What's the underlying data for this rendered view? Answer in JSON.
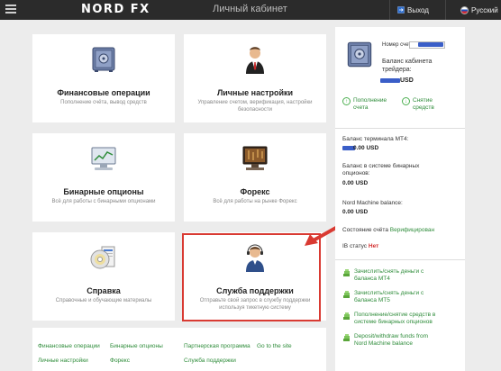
{
  "header": {
    "logo_left": "NORD",
    "logo_right": "FX",
    "title": "Личный кабинет",
    "logout_label": "Выход",
    "lang_label": "Русский"
  },
  "tiles": [
    {
      "title": "Финансовые операции",
      "desc": "Пополнение счёта, вывод средств",
      "icon": "safe-icon"
    },
    {
      "title": "Личные настройки",
      "desc": "Управление счетом, верификация, настройки безопасности",
      "icon": "user-icon"
    },
    {
      "title": "Бинарные опционы",
      "desc": "Всё для работы с бинарными опционами",
      "icon": "computer-chart-icon"
    },
    {
      "title": "Форекс",
      "desc": "Всё для работы на рынке Форекс",
      "icon": "trading-monitor-icon"
    },
    {
      "title": "Справка",
      "desc": "Справочные и обучающие материалы",
      "icon": "cd-book-icon"
    },
    {
      "title": "Служба поддержки",
      "desc": "Отправьте свой запрос в службу поддержки используя тикетную систему",
      "icon": "support-agent-icon"
    }
  ],
  "footer_links": {
    "col1": [
      "Финансовые операции",
      "Личные настройки"
    ],
    "col2": [
      "Бинарные опционы",
      "Форекс"
    ],
    "col3": [
      "Партнерская программа",
      "Служба поддержки"
    ],
    "site": "Go to the site"
  },
  "panel": {
    "account_label": "Номер счета:",
    "balance_label_1": "Баланс кабинета",
    "balance_label_2": "трейдера:",
    "balance_currency": "USD",
    "deposit_1": "Пополнение",
    "deposit_2": "счета",
    "withdraw_1": "Снятие",
    "withdraw_2": "средств",
    "mt4_label": "Баланс терминала MT4:",
    "mt4_value": "0.00 USD",
    "binary_label_1": "Баланс в системе бинарных",
    "binary_label_2": "опционов:",
    "binary_value": "0.00 USD",
    "nm_label": "Nord Machine balance:",
    "nm_value": "0.00 USD",
    "status_label": "Состояние счёта",
    "status_value": "Верифицирован",
    "ib_label": "IB статус",
    "ib_value": "Нет",
    "links": [
      [
        "Зачислить/снять деньги с",
        "баланса MT4"
      ],
      [
        "Зачислить/снять деньги с",
        "баланса MT5"
      ],
      [
        "Пополнение/снятие средств в",
        "системе бинарных опционов"
      ],
      [
        "Deposit/withdraw funds from",
        "Nord Machine balance"
      ]
    ]
  },
  "colors": {
    "highlight": "#d93a32",
    "link_green": "#2e8c3a",
    "header_bg": "#2b2b2b",
    "masked_blue": "#3a5ec8"
  }
}
